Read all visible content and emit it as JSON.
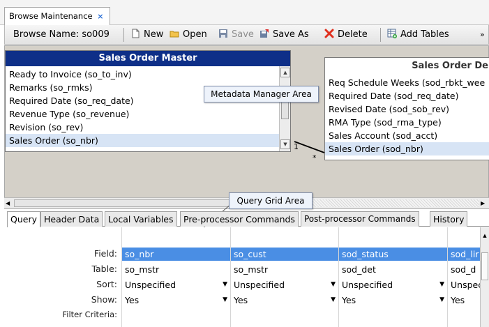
{
  "doc_tab": {
    "label": "Browse Maintenance",
    "close": "×"
  },
  "toolbar": {
    "browse_name_label": "Browse Name: so009",
    "new_label": "New",
    "open_label": "Open",
    "save_label": "Save",
    "save_as_label": "Save As",
    "delete_label": "Delete",
    "add_tables_label": "Add Tables"
  },
  "metadata": {
    "callout": "Metadata Manager Area",
    "left_table": {
      "title": "Sales Order Master",
      "rows": [
        "Ready to Invoice (so_to_inv)",
        "Remarks (so_rmks)",
        "Required Date (so_req_date)",
        "Revenue Type (so_revenue)",
        "Revision (so_rev)",
        "Sales Order (so_nbr)"
      ],
      "selected_index": 5
    },
    "right_table": {
      "title": "Sales Order De",
      "rows": [
        "Req Schedule Weeks (sod_rbkt_wee",
        "Required Date (sod_req_date)",
        "Revised Date (sod_sob_rev)",
        "RMA Type (sod_rma_type)",
        "Sales Account (sod_acct)",
        "Sales Order (sod_nbr)"
      ],
      "selected_index": 5
    },
    "join_left": "1",
    "join_right": "*"
  },
  "query_grid": {
    "callout": "Query Grid Area",
    "tabs": [
      "Query",
      "Header Data",
      "Local Variables",
      "Pre-processor Commands",
      "Post-processor Commands",
      "History"
    ],
    "active_tab": 0,
    "row_labels": {
      "field": "Field:",
      "table": "Table:",
      "sort": "Sort:",
      "show": "Show:",
      "filter": "Filter Criteria:"
    },
    "columns": [
      {
        "field": "so_nbr",
        "table": "so_mstr",
        "sort": "Unspecified",
        "show": "Yes"
      },
      {
        "field": "so_cust",
        "table": "so_mstr",
        "sort": "Unspecified",
        "show": "Yes"
      },
      {
        "field": "sod_status",
        "table": "sod_det",
        "sort": "Unspecified",
        "show": "Yes"
      },
      {
        "field": "sod_lir",
        "table": "sod_d",
        "sort": "Unspec",
        "show": "Yes"
      }
    ]
  }
}
